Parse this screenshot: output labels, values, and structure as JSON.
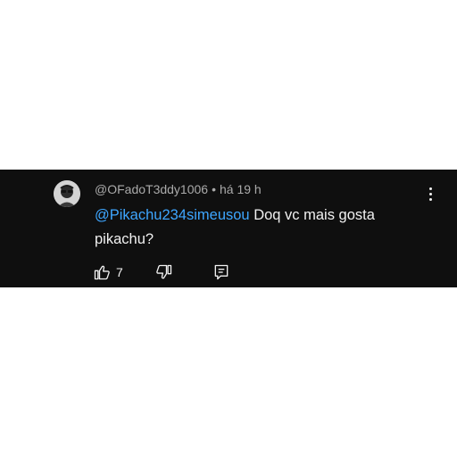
{
  "comment": {
    "author": "@OFadoT3ddy1006",
    "separator": "•",
    "time": "há 19 h",
    "mention": "@Pikachu234simeusou",
    "text": " Doq vc mais gosta pikachu?",
    "like_count": "7"
  },
  "colors": {
    "background": "#0f0f0f",
    "mention": "#3ea6ff",
    "meta_text": "#aaaaaa",
    "primary_text": "#f1f1f1"
  },
  "icons": {
    "like": "thumbs-up-icon",
    "dislike": "thumbs-down-icon",
    "reply": "reply-icon",
    "menu": "kebab-menu-icon"
  }
}
